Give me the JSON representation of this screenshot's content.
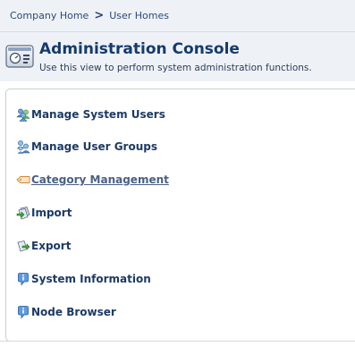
{
  "breadcrumb": {
    "items": [
      "Company Home",
      "User Homes"
    ],
    "separator": ">"
  },
  "header": {
    "title": "Administration Console",
    "subtitle": "Use this view to perform system administration functions.",
    "icon": "admin-console-icon"
  },
  "menu": {
    "items": [
      {
        "label": "Manage System Users",
        "icon": "users-icon"
      },
      {
        "label": "Manage User Groups",
        "icon": "user-groups-icon"
      },
      {
        "label": "Category Management",
        "icon": "category-tag-icon"
      },
      {
        "label": "Import",
        "icon": "import-icon"
      },
      {
        "label": "Export",
        "icon": "export-icon"
      },
      {
        "label": "System Information",
        "icon": "info-icon"
      },
      {
        "label": "Node Browser",
        "icon": "info-icon"
      }
    ]
  },
  "colors": {
    "header_background": "#eef2f7",
    "title": "#163a6d",
    "link": "#1c3a66",
    "hovered_link": "#4a5f85"
  }
}
